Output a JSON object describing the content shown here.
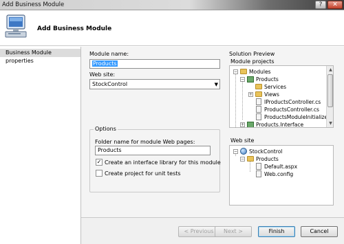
{
  "window": {
    "title": "Add Business Module",
    "help_glyph": "?",
    "close_glyph": "✕"
  },
  "header": {
    "title": "Add Business Module",
    "icon": "computer-icon"
  },
  "sidebar": {
    "items": [
      {
        "label": "Business Module properties",
        "selected": true
      }
    ]
  },
  "form": {
    "module_name_label": "Module name:",
    "module_name_value": "Products",
    "website_label": "Web site:",
    "website_value": "StockControl",
    "dropdown_arrow": "▼"
  },
  "options": {
    "title": "Options",
    "folder_label": "Folder name for module Web pages:",
    "folder_value": "Products",
    "checkboxes": [
      {
        "label": "Create an interface library for this module",
        "checked": true,
        "mark": "✓"
      },
      {
        "label": "Create project for unit tests",
        "checked": false,
        "mark": ""
      }
    ]
  },
  "solution_preview": {
    "title": "Solution Preview",
    "module_projects_label": "Module projects",
    "module_tree": [
      {
        "label": "Modules",
        "icon": "folder-icon",
        "expander": "−"
      },
      {
        "label": "Products",
        "icon": "project-icon",
        "expander": "−"
      },
      {
        "label": "Services",
        "icon": "folder-icon",
        "expander": ""
      },
      {
        "label": "Views",
        "icon": "folder-icon",
        "expander": "+"
      },
      {
        "label": "IProductsController.cs",
        "icon": "cs-file-icon",
        "expander": ""
      },
      {
        "label": "ProductsController.cs",
        "icon": "cs-file-icon",
        "expander": ""
      },
      {
        "label": "ProductsModuleInitializer.c",
        "icon": "cs-file-icon",
        "expander": ""
      },
      {
        "label": "Products.Interface",
        "icon": "project-icon",
        "expander": "+"
      }
    ],
    "website_label": "Web site",
    "website_tree": [
      {
        "label": "StockControl",
        "icon": "website-icon",
        "expander": "−"
      },
      {
        "label": "Products",
        "icon": "folder-icon",
        "expander": "−"
      },
      {
        "label": "Default.aspx",
        "icon": "aspx-file-icon",
        "expander": ""
      },
      {
        "label": "Web.config",
        "icon": "config-file-icon",
        "expander": ""
      }
    ],
    "scroll_up": "▲",
    "scroll_down": "▼"
  },
  "footer": {
    "previous_label": "< Previous",
    "next_label": "Next >",
    "finish_label": "Finish",
    "cancel_label": "Cancel"
  }
}
